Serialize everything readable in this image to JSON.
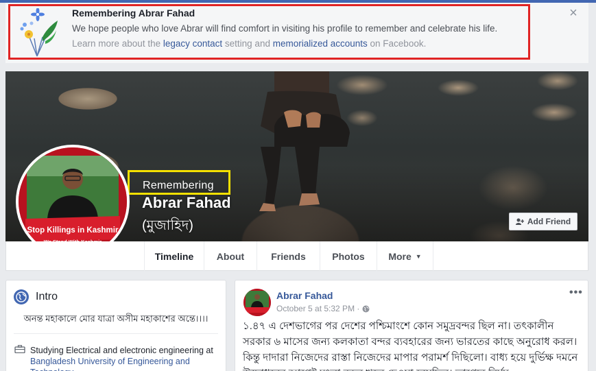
{
  "memorial_banner": {
    "title": "Remembering Abrar Fahad",
    "message": "We hope people who love Abrar will find comfort in visiting his profile to remember and celebrate his life.",
    "learn_prefix": "Learn more about the ",
    "legacy_link": "legacy contact",
    "learn_middle": " setting and ",
    "memorialized_link": "memorialized accounts",
    "learn_suffix": " on Facebook.",
    "close_icon": "close-icon"
  },
  "profile": {
    "remembering_label": "Remembering",
    "name": "Abrar Fahad",
    "alternate_name": "(মুজাহিদ)",
    "avatar_caption_line1": "Stop Killings in Kashmir",
    "avatar_caption_line2": "We Stand With Kashmir",
    "add_friend_label": "Add Friend"
  },
  "tabs": [
    {
      "label": "Timeline",
      "active": true
    },
    {
      "label": "About",
      "active": false
    },
    {
      "label": "Friends",
      "active": false
    },
    {
      "label": "Photos",
      "active": false
    },
    {
      "label": "More",
      "active": false
    }
  ],
  "intro": {
    "title": "Intro",
    "bio": "অনন্ত মহাকালে মোর যাত্রা অসীম মহাকাশের অন্তে।।।।",
    "study_prefix": "Studying Electrical and electronic engineering at ",
    "study_link": "Bangladesh University of Engineering and Technology"
  },
  "post": {
    "author": "Abrar Fahad",
    "timestamp": "October 5 at 5:32 PM · ",
    "body": "১.৪৭ এ দেশভাগের পর দেশের পশ্চিমাংশে কোন সমুদ্রবন্দর ছিল না। তৎকালীন সরকার ৬ মাসের জন্য কলকাতা বন্দর ব্যবহারের জন্য ভারতের কাছে অনুরোধ করল। কিন্তু দাদারা নিজেদের রাস্তা নিজেদের মাপার পরামর্শ দিছিলো। বাধ্য হয়ে দুর্ভিক্ষ দমনে উদ্বোধনের আগেই মংলা বন্দর খুলে দেওয়া হয়েছিল। ভাগ্যের নির্মম"
  },
  "colors": {
    "facebook_blue": "#4267b2",
    "link_blue": "#365899",
    "highlight_red": "#e02424",
    "highlight_yellow": "#f5e100"
  }
}
